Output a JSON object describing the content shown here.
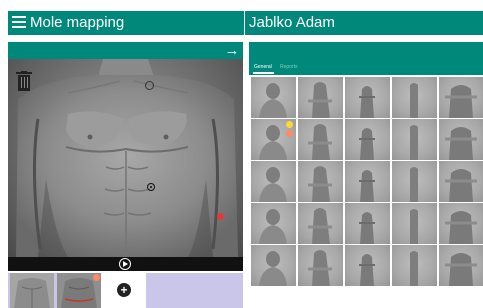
{
  "app": {
    "title": "Mole mapping",
    "patient_name": "Jablko Adam"
  },
  "toolbar": {
    "menu_icon": "hamburger-icon",
    "next_icon": "arrow-right-icon"
  },
  "viewer": {
    "delete_icon": "trash-icon",
    "play_icon": "play-circle-icon"
  },
  "thumbnails": {
    "add_icon": "plus-circle-icon"
  },
  "tabs": [
    {
      "label": "General",
      "active": true
    },
    {
      "label": "Reports",
      "active": false
    }
  ],
  "colors": {
    "primary": "#00897b",
    "mole_red": "#e53935",
    "badge_yellow": "#fdd835",
    "badge_orange": "#ff8a65",
    "thumb_strip": "#c9c6ea"
  },
  "body_grid": {
    "rows": 5,
    "cols": 5,
    "cells": [
      [
        "head-front",
        "head-side",
        "head-back",
        "head-side-2",
        "head-top"
      ],
      [
        "torso-front",
        "torso-side",
        "torso-back",
        "torso-side-2",
        "torso-front-arms"
      ],
      [
        "pelvis-front",
        "pelvis-side",
        "pelvis-back",
        "pelvis-side-2",
        "hands"
      ],
      [
        "thighs-front",
        "thighs-side",
        "thighs-back",
        "thighs-side-2",
        "thighs-back-2"
      ],
      [
        "legs-front",
        "legs-side",
        "legs-back",
        "legs-side-2",
        "feet"
      ]
    ]
  }
}
